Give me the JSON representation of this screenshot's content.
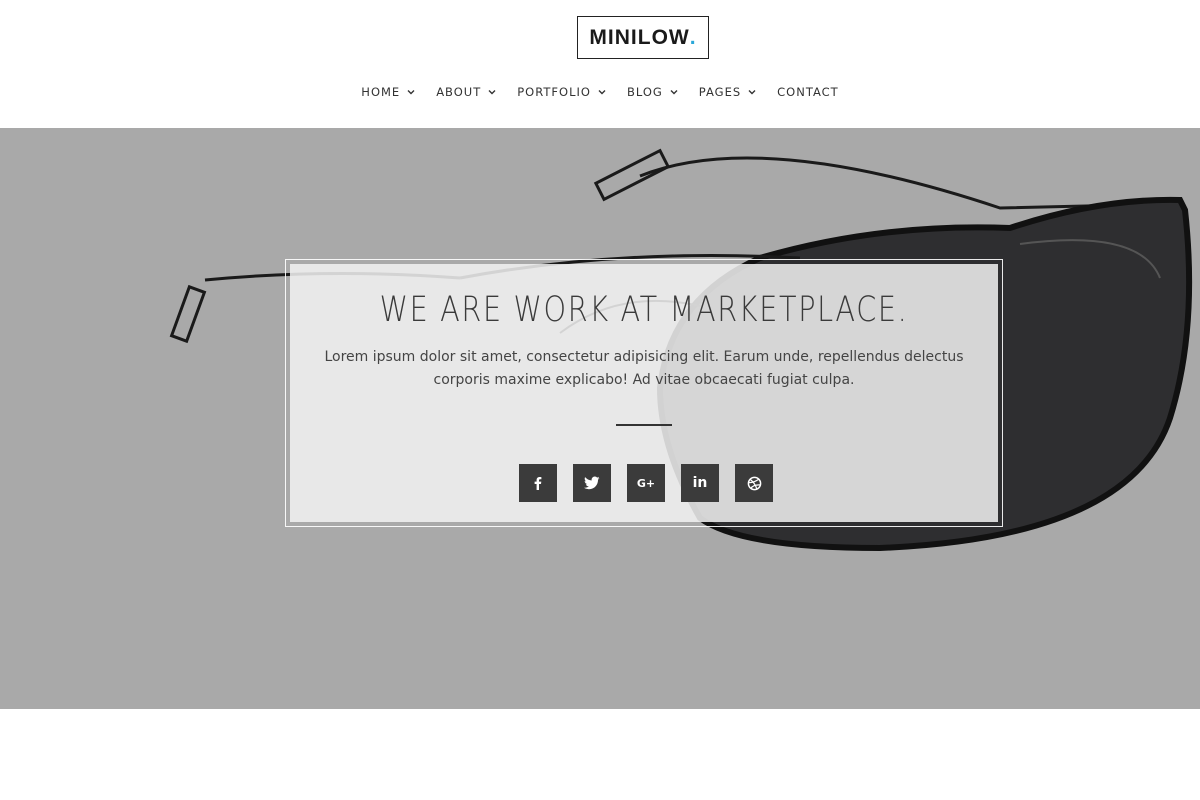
{
  "brand": {
    "name": "MINILOW",
    "dot": ".",
    "dot_color": "#2aa7d8"
  },
  "nav": {
    "items": [
      {
        "label": "HOME",
        "dropdown": true
      },
      {
        "label": "ABOUT",
        "dropdown": true
      },
      {
        "label": "PORTFOLIO",
        "dropdown": true
      },
      {
        "label": "BLOG",
        "dropdown": true
      },
      {
        "label": "PAGES",
        "dropdown": true
      },
      {
        "label": "CONTACT",
        "dropdown": false
      }
    ]
  },
  "hero": {
    "background_color": "#a9a9a9",
    "title": "WE ARE WORK AT MARKETPLACE.",
    "text": "Lorem ipsum dolor sit amet, consectetur adipisicing elit. Earum unde, repellendus delectus corporis maxime explicabo! Ad vitae obcaecati fugiat culpa.",
    "socials": [
      {
        "icon": "facebook-icon"
      },
      {
        "icon": "twitter-icon"
      },
      {
        "icon": "google-plus-icon",
        "glyph": "G+"
      },
      {
        "icon": "linkedin-icon",
        "glyph": "in"
      },
      {
        "icon": "dribbble-icon"
      }
    ]
  }
}
